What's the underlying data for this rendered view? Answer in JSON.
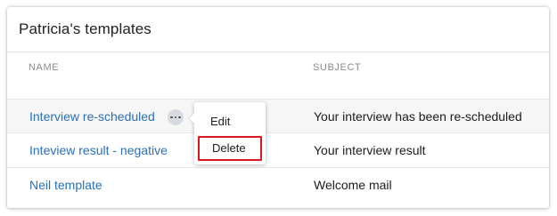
{
  "panel": {
    "title": "Patricia's templates"
  },
  "table": {
    "columns": {
      "name": "NAME",
      "subject": "SUBJECT"
    },
    "rows": [
      {
        "name": "Interview re-scheduled",
        "subject": "Your interview has been re-scheduled"
      },
      {
        "name": "Inteview result - negative",
        "subject": "Your interview result"
      },
      {
        "name": "Neil template",
        "subject": "Welcome mail"
      }
    ]
  },
  "context_menu": {
    "edit_label": "Edit",
    "delete_label": "Delete",
    "highlight_color": "#e0141e"
  },
  "icons": {
    "more": "more-options-icon"
  },
  "colors": {
    "link": "#2a70b8",
    "header_text": "#8a8a8a"
  }
}
